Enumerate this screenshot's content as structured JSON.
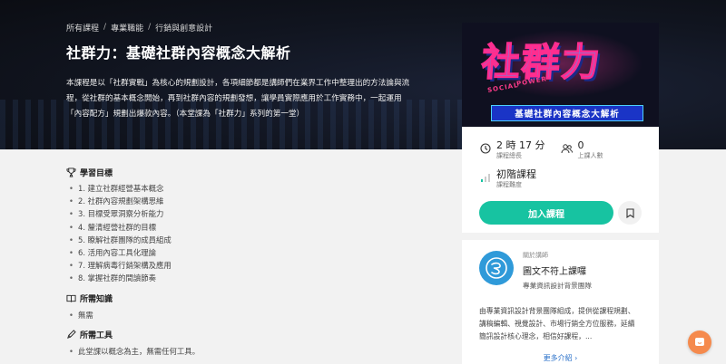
{
  "breadcrumb": [
    "所有課程",
    "專業職能",
    "行銷與創意設計"
  ],
  "course": {
    "title": "社群力：基礎社群內容概念大解析",
    "intro": "本課程是以「社群實戰」為核心的規劃設計，各項細節都是講師們在業界工作中整理出的方法論與流程，從社群的基本概念開始，再到社群內容的規劃發想，讓學員實際應用於工作實務中，一起運用「內容配方」規劃出爆款內容。（本堂課為「社群力」系列的第一堂）"
  },
  "goals": {
    "title": "學習目標",
    "items": [
      "1. 建立社群經營基本概念",
      "2. 社群內容規劃架構思維",
      "3. 目標受眾洞察分析能力",
      "4. 釐清經營社群的目標",
      "5. 瞭解社群團隊的成員組成",
      "6. 活用內容工具化理論",
      "7. 理解病毒行銷架構及應用",
      "8. 掌握社群的間讀節奏"
    ]
  },
  "knowledge": {
    "title": "所需知識",
    "items": [
      "無需"
    ]
  },
  "tools": {
    "title": "所需工具",
    "items": [
      "此堂課以概念為主，無需任何工具。"
    ]
  },
  "thumbnail": {
    "big": "社群力",
    "social": "SOCIAL",
    "power": "POWER",
    "banner": "基礎社群內容概念大解析",
    "colors": {
      "blue": "#3aa2ff",
      "pink": "#ff2d8f",
      "banner": "#1a34c6"
    }
  },
  "stats": {
    "duration_value": "2 時 17 分",
    "duration_label": "課程總長",
    "students_value": "0",
    "students_label": "上課人數",
    "level_value": "初階課程",
    "level_label": "課程難度"
  },
  "cta": {
    "join_label": "加入課程",
    "accent": "#17c3a1"
  },
  "teacher": {
    "about_label": "關於講師",
    "name": "圖文不符上課囉",
    "subtitle": "專業資訊設計背景團隊",
    "description": "由專業資訊設計背景團隊組成，提供從課程規劃、講稿編輯、視覺設計、市場行銷全方位服務，延續簡訊設計核心理念，相信好課程，...",
    "more_label": "更多介紹",
    "avatar_color": "#2f9ad9"
  },
  "chat": {
    "color": "#f58a4d"
  }
}
